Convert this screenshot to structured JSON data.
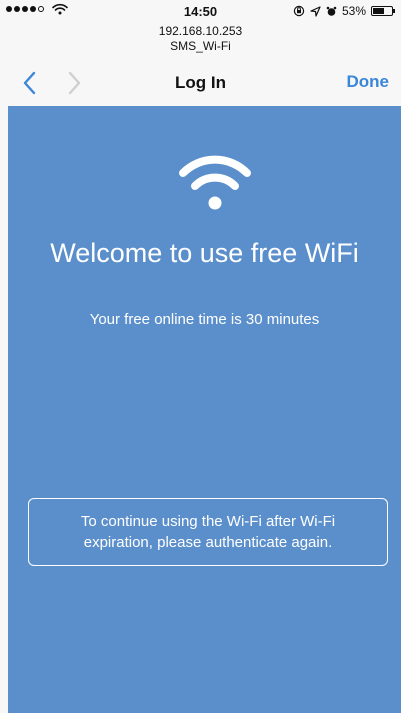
{
  "status_bar": {
    "time": "14:50",
    "battery_percent": "53%",
    "battery_level": 0.53,
    "signal_bars_filled": 4,
    "signal_bars_total": 5,
    "icons": [
      "signal-icon",
      "wifi-icon",
      "orientation-lock-icon",
      "location-icon",
      "alarm-icon",
      "battery-icon"
    ]
  },
  "header": {
    "ip": "192.168.10.253",
    "ssid": "SMS_Wi-Fi"
  },
  "nav": {
    "title": "Log In",
    "done_label": "Done",
    "back_icon": "chevron-left-icon",
    "forward_icon": "chevron-right-icon"
  },
  "main": {
    "icon": "wifi-icon",
    "welcome": "Welcome to use free WiFi",
    "free_time": "Your free online time is 30 minutes",
    "notice": "To continue using the Wi-Fi after Wi-Fi expiration, please authenticate again."
  },
  "colors": {
    "accent": "#3b86d9",
    "content_bg": "#5b8fcc"
  }
}
